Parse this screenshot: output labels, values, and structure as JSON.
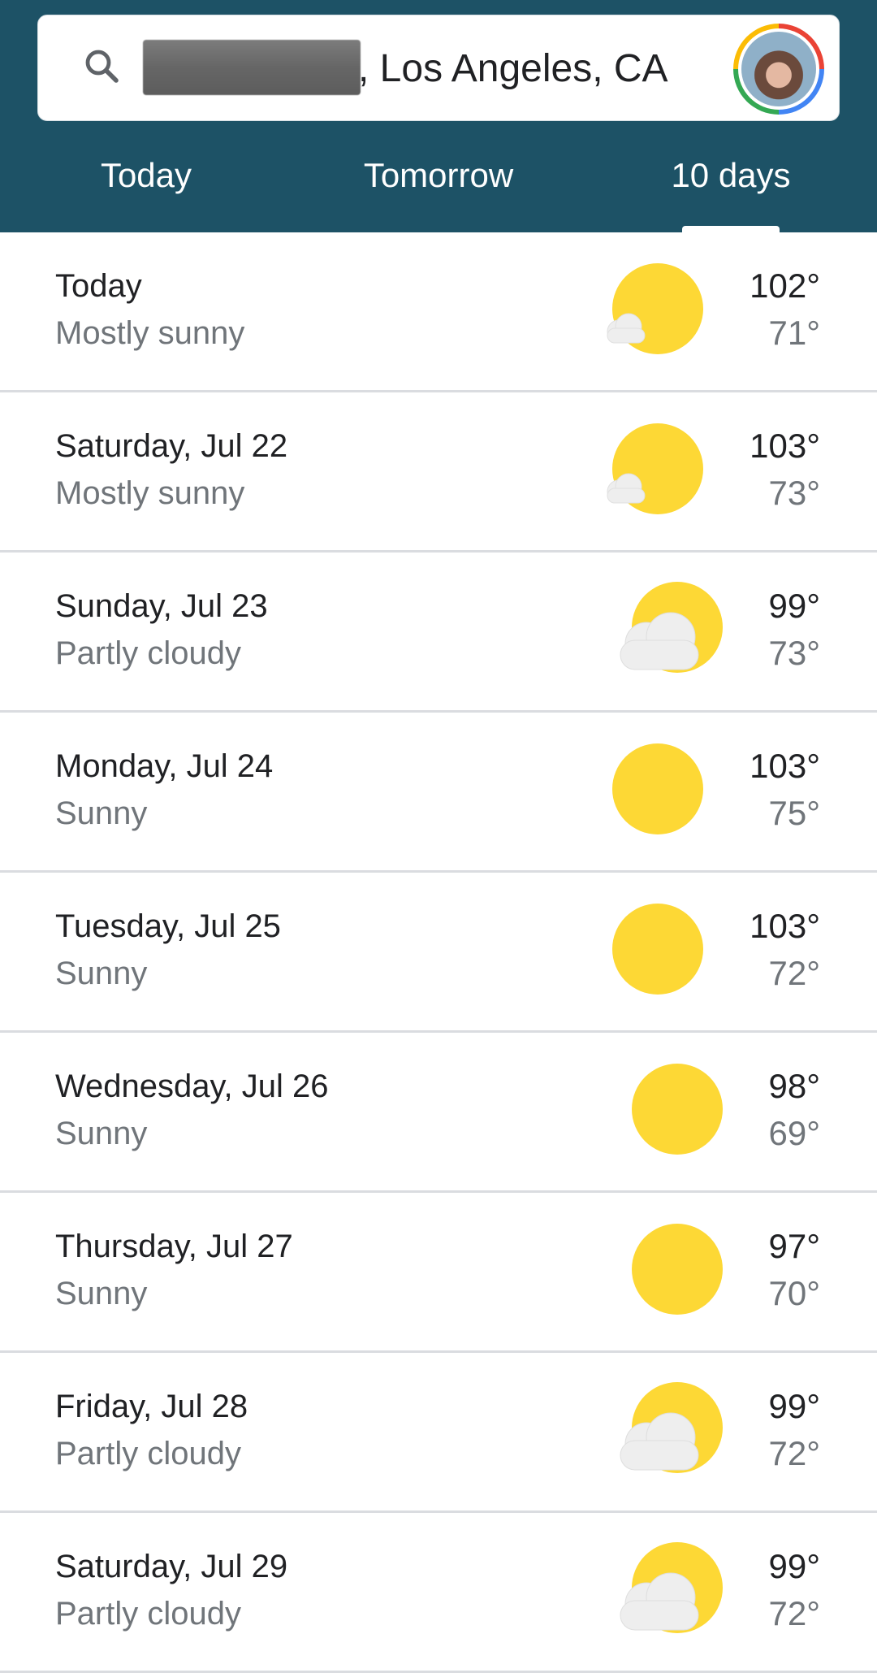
{
  "search": {
    "location": ", Los Angeles, CA"
  },
  "tabs": [
    {
      "label": "Today"
    },
    {
      "label": "Tomorrow"
    },
    {
      "label": "10 days",
      "selected": true
    }
  ],
  "forecast": [
    {
      "day": "Today",
      "condition": "Mostly sunny",
      "icon": "mostly-sunny-icon",
      "high": "102°",
      "low": "71°"
    },
    {
      "day": "Saturday, Jul 22",
      "condition": "Mostly sunny",
      "icon": "mostly-sunny-icon",
      "high": "103°",
      "low": "73°"
    },
    {
      "day": "Sunday, Jul 23",
      "condition": "Partly cloudy",
      "icon": "partly-cloudy-icon",
      "high": "99°",
      "low": "73°"
    },
    {
      "day": "Monday, Jul 24",
      "condition": "Sunny",
      "icon": "sunny-icon",
      "high": "103°",
      "low": "75°"
    },
    {
      "day": "Tuesday, Jul 25",
      "condition": "Sunny",
      "icon": "sunny-icon",
      "high": "103°",
      "low": "72°"
    },
    {
      "day": "Wednesday, Jul 26",
      "condition": "Sunny",
      "icon": "sunny-icon",
      "high": "98°",
      "low": "69°"
    },
    {
      "day": "Thursday, Jul 27",
      "condition": "Sunny",
      "icon": "sunny-icon",
      "high": "97°",
      "low": "70°"
    },
    {
      "day": "Friday, Jul 28",
      "condition": "Partly cloudy",
      "icon": "partly-cloudy-icon",
      "high": "99°",
      "low": "72°"
    },
    {
      "day": "Saturday, Jul 29",
      "condition": "Partly cloudy",
      "icon": "partly-cloudy-icon",
      "high": "99°",
      "low": "72°"
    }
  ],
  "colors": {
    "header": "#1d5266",
    "sun": "#fdd835",
    "cloud": "#eeeeee"
  }
}
